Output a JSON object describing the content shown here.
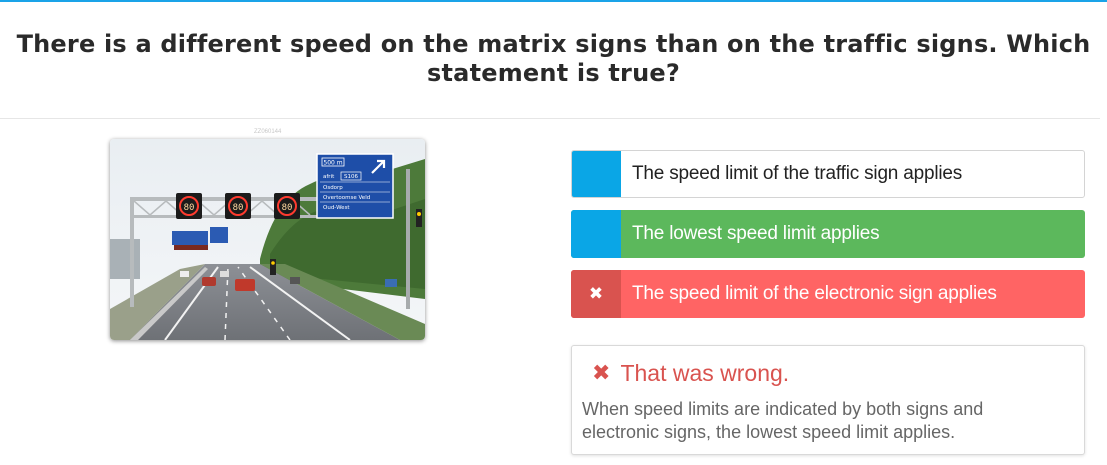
{
  "question": "There is a different speed on the matrix signs than on the traffic signs. Which statement is true?",
  "watermark": "ZZ060144",
  "photo": {
    "speed_signs": [
      "80",
      "80",
      "80"
    ],
    "direction_sign": [
      "500 m",
      "afrit",
      "S106",
      "Osdorp",
      "Overtoomse Veld",
      "Oud-West"
    ]
  },
  "answers": [
    {
      "label": "The speed limit of the traffic sign applies",
      "state": "neutral",
      "marker_color": "#0aa6e6"
    },
    {
      "label": "The lowest speed limit applies",
      "state": "correct",
      "marker_color": "#0aa6e6",
      "bg_color": "#5cb85c"
    },
    {
      "label": "The speed limit of the electronic sign applies",
      "state": "selected-wrong",
      "marker_color": "#d9534f",
      "bg_color": "#ff6464",
      "marker_icon": "close-icon"
    }
  ],
  "feedback": {
    "icon": "close-icon",
    "title": "That was wrong.",
    "explanation": "When speed limits are indicated by both signs and electronic signs, the lowest speed limit applies.",
    "color": "#d9534f"
  }
}
